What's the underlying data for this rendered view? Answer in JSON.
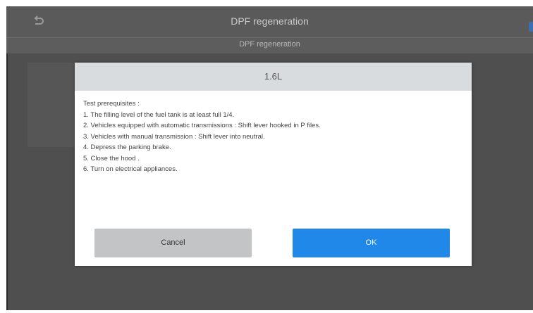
{
  "app": {
    "title": "DPF regeneration",
    "subtitle": "DPF regeneration"
  },
  "dialog": {
    "title": "1.6L",
    "heading": "Test prerequisites :",
    "items": [
      "1. The filling level of the fuel tank is at least full 1/4.",
      "2. Vehicles equipped with automatic transmissions : Shift lever hooked in P files.",
      "3. Vehicles with manual transmission : Shift lever into neutral.",
      "4. Depress the parking brake.",
      "5. Close the hood .",
      "6. Turn on electrical appliances."
    ],
    "cancel_label": "Cancel",
    "ok_label": "OK"
  },
  "colors": {
    "ok_button": "#1f88e8",
    "cancel_button": "#c3c4c6",
    "dialog_header": "#d9dcdf"
  }
}
